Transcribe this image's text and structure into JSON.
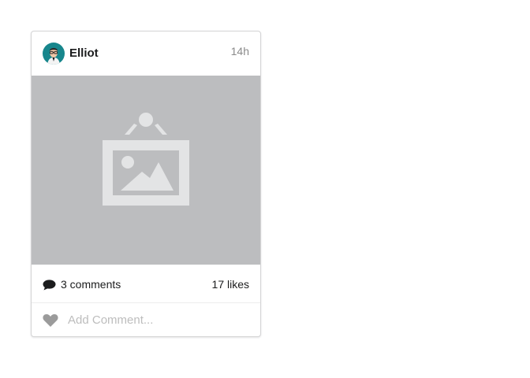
{
  "post": {
    "author": "Elliot",
    "time": "14h",
    "image_icon": "image-placeholder-icon",
    "comments_label": "3 comments",
    "likes_label": "17 likes",
    "comment_placeholder": "Add Comment...",
    "icons": {
      "avatar": "avatar-elliot",
      "comment": "comment-icon",
      "like": "heart-icon"
    },
    "colors": {
      "image_bg": "#bcbdbf",
      "image_icon": "#e3e4e5",
      "avatar_bg": "#17868c",
      "text": "#1b1c1d",
      "muted": "#8a8a8a"
    }
  }
}
